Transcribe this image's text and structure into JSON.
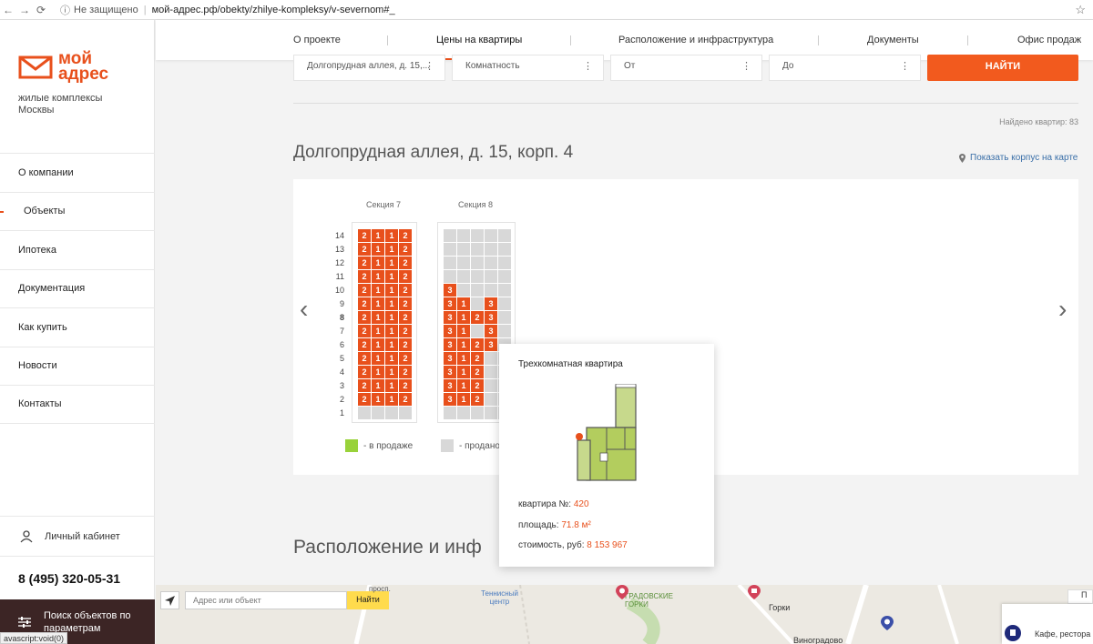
{
  "browser": {
    "secure_label": "Не защищено",
    "url": "мой-адрес.рф/obekty/zhilye-kompleksy/v-severnom#_"
  },
  "sidebar": {
    "logo_line1": "мой",
    "logo_line2": "адрес",
    "tagline": "жилые комплексы Москвы",
    "menu": [
      "О компании",
      "Объекты",
      "Ипотека",
      "Документация",
      "Как купить",
      "Новости",
      "Контакты"
    ],
    "cabinet": "Личный кабинет",
    "phone": "8 (495) 320-05-31",
    "search_params": "Поиск объектов по параметрам",
    "status_url": "avascript:void(0)"
  },
  "topnav": {
    "tabs": [
      "О проекте",
      "Цены на квартиры",
      "Расположение и инфраструктура",
      "Документы",
      "Офис продаж"
    ]
  },
  "filters": {
    "address": "Долгопрудная аллея, д. 15,...",
    "rooms": "Комнатность",
    "from": "От",
    "to": "До",
    "find": "НАЙТИ"
  },
  "results": {
    "found": "Найдено квартир: 83",
    "building_title": "Долгопрудная аллея, д. 15, корп. 4",
    "map_link": "Показать корпус на карте"
  },
  "chess": {
    "sections": [
      "Секция 7",
      "Секция 8"
    ],
    "floors": [
      "14",
      "13",
      "12",
      "11",
      "10",
      "9",
      "8",
      "7",
      "6",
      "5",
      "4",
      "3",
      "2",
      "1"
    ],
    "section7_rows": [
      [
        "2",
        "1",
        "1",
        "2"
      ],
      [
        "2",
        "1",
        "1",
        "2"
      ],
      [
        "2",
        "1",
        "1",
        "2"
      ],
      [
        "2",
        "1",
        "1",
        "2"
      ],
      [
        "2",
        "1",
        "1",
        "2"
      ],
      [
        "2",
        "1",
        "1",
        "2"
      ],
      [
        "2",
        "1",
        "1",
        "2"
      ],
      [
        "2",
        "1",
        "1",
        "2"
      ],
      [
        "2",
        "1",
        "1",
        "2"
      ],
      [
        "2",
        "1",
        "1",
        "2"
      ],
      [
        "2",
        "1",
        "1",
        "2"
      ],
      [
        "2",
        "1",
        "1",
        "2"
      ],
      [
        "2",
        "1",
        "1",
        "2"
      ],
      [
        "",
        "",
        "",
        ""
      ]
    ],
    "section8_rows": [
      [
        "",
        "",
        "",
        "",
        ""
      ],
      [
        "",
        "",
        "",
        "",
        ""
      ],
      [
        "",
        "",
        "",
        "",
        ""
      ],
      [
        "",
        "",
        "",
        "",
        ""
      ],
      [
        "3",
        "",
        "",
        "",
        ""
      ],
      [
        "3",
        "1",
        "",
        "3",
        ""
      ],
      [
        "3",
        "1",
        "2",
        "3",
        ""
      ],
      [
        "3",
        "1",
        "",
        "3",
        ""
      ],
      [
        "3",
        "1",
        "2",
        "3",
        ""
      ],
      [
        "3",
        "1",
        "2",
        "",
        ""
      ],
      [
        "3",
        "1",
        "2",
        "",
        ""
      ],
      [
        "3",
        "1",
        "2",
        "",
        ""
      ],
      [
        "3",
        "1",
        "2",
        "",
        ""
      ],
      [
        "",
        "",
        "",
        "",
        ""
      ]
    ],
    "legend_sale": "- в продаже",
    "legend_sold": "- продано",
    "colors": {
      "sale": "#e8501c",
      "sold": "#d8d8d8",
      "legend_sale": "#99d23a"
    }
  },
  "tooltip": {
    "title": "Трехкомнатная квартира",
    "number_label": "квартира №:",
    "number": "420",
    "area_label": "площадь:",
    "area": "71.8 м²",
    "price_label": "стоимость, руб:",
    "price": "8 153 967"
  },
  "location": {
    "title": "Расположение и инф"
  },
  "map": {
    "placeholder": "Адрес или объект",
    "button": "Найти",
    "labels": [
      "просп.",
      "Теннисный центр",
      "ГРАДОВСКИЕ ГОРКИ",
      "Горки",
      "Виноградово",
      "Кафе, рестора",
      "П"
    ]
  }
}
